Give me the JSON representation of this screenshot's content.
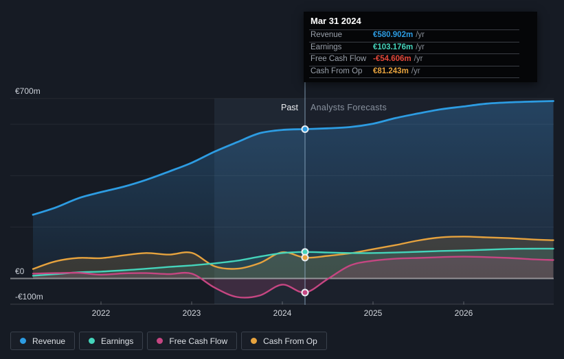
{
  "tooltip": {
    "date": "Mar 31 2024",
    "rows": [
      {
        "label": "Revenue",
        "value": "€580.902m",
        "suffix": "/yr",
        "color": "#2d9ce2"
      },
      {
        "label": "Earnings",
        "value": "€103.176m",
        "suffix": "/yr",
        "color": "#45d4bb"
      },
      {
        "label": "Free Cash Flow",
        "value": "-€54.606m",
        "suffix": "/yr",
        "color": "#e4483a"
      },
      {
        "label": "Cash From Op",
        "value": "€81.243m",
        "suffix": "/yr",
        "color": "#e7a33e"
      }
    ]
  },
  "legend": {
    "items": [
      {
        "label": "Revenue",
        "color": "#2d9ce2"
      },
      {
        "label": "Earnings",
        "color": "#45d4bb"
      },
      {
        "label": "Free Cash Flow",
        "color": "#c64682"
      },
      {
        "label": "Cash From Op",
        "color": "#e7a33e"
      }
    ]
  },
  "chart_data": {
    "type": "area",
    "currency": "EUR",
    "unit": "millions",
    "x": [
      2021.25,
      2021.5,
      2021.75,
      2022,
      2022.25,
      2022.5,
      2022.75,
      2023,
      2023.25,
      2023.5,
      2023.75,
      2024,
      2024.25,
      2024.5,
      2024.75,
      2025,
      2025.25,
      2025.5,
      2025.75,
      2026,
      2026.25,
      2026.5,
      2026.75,
      2027
    ],
    "series": [
      {
        "name": "Revenue",
        "color": "#2d9ce2",
        "values": [
          248,
          276,
          312,
          336,
          357,
          384,
          416,
          450,
          493,
          530,
          565,
          578,
          580.902,
          584,
          589,
          602,
          624,
          642,
          658,
          669,
          680,
          685,
          688,
          690
        ]
      },
      {
        "name": "Earnings",
        "color": "#45d4bb",
        "values": [
          11,
          17,
          24,
          27,
          32,
          38,
          45,
          51,
          59,
          69,
          85,
          99,
          103.176,
          101,
          99,
          99,
          101,
          104,
          107,
          109,
          112,
          115,
          116,
          116
        ]
      },
      {
        "name": "Free Cash Flow",
        "color": "#c64682",
        "values": [
          19,
          21,
          22,
          15,
          20,
          21,
          17,
          19,
          -35,
          -72,
          -66,
          -24,
          -54.606,
          -2,
          51,
          69,
          77,
          80,
          83,
          85,
          83,
          80,
          75,
          72
        ]
      },
      {
        "name": "Cash From Op",
        "color": "#e7a33e",
        "values": [
          37,
          67,
          80,
          79,
          90,
          99,
          93,
          100,
          48,
          38,
          60,
          102,
          81.243,
          88,
          98,
          114,
          130,
          148,
          160,
          163,
          160,
          157,
          152,
          149
        ]
      }
    ],
    "marker_x": 2024.25,
    "divider_x": 2024.25,
    "past_band": [
      2023.25,
      2024.25
    ],
    "x_ticks": [
      {
        "value": 2022,
        "label": "2022"
      },
      {
        "value": 2023,
        "label": "2023"
      },
      {
        "value": 2024,
        "label": "2024"
      },
      {
        "value": 2025,
        "label": "2025"
      },
      {
        "value": 2026,
        "label": "2026"
      }
    ],
    "y_axis_labels": [
      {
        "value": 700,
        "label": "€700m"
      },
      {
        "value": 0,
        "label": "€0"
      },
      {
        "value": -100,
        "label": "-€100m"
      }
    ],
    "y_gridlines": [
      700,
      600,
      400,
      200,
      0,
      -100
    ],
    "ylim": [
      -110,
      760
    ],
    "xlim": [
      2021.25,
      2027
    ],
    "grid": "horizontal",
    "legend_position": "bottom",
    "region_labels": {
      "past": "Past",
      "forecast": "Analysts Forecasts"
    }
  }
}
